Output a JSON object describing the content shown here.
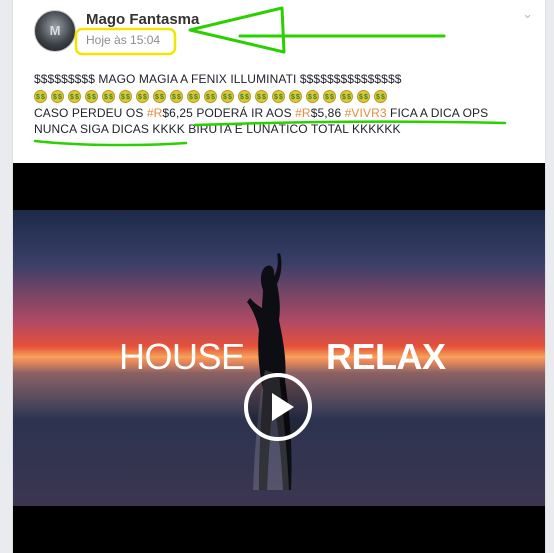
{
  "post": {
    "author": "Mago Fantasma",
    "avatar_letter": "M",
    "timestamp": "Hoje às 15:04",
    "line1": "$$$$$$$$$ MAGO MAGIA A FENIX ILLUMINATI $$$$$$$$$$$$$$$",
    "emoji_name": "money-mouth-face-emoji",
    "emoji_count": 21,
    "line3_a": "CASO PERDEU OS ",
    "line3_tag1": "#R",
    "line3_b": "$6,25 PODERÁ IR AOS ",
    "line3_tag2": "#R",
    "line3_c": "$5,86 ",
    "line3_tag3": "#VIVR3",
    "line3_d": " FICA A DICA OPS",
    "line4": "NUNCA SIGA DICAS KKKK BIRUTA E LUNÁTICO TOTAL KKKKKK"
  },
  "video": {
    "title_left": "HOUSE",
    "title_right": "RELAX"
  },
  "colors": {
    "hashtag": "#e98a3a",
    "annotation_green": "#2bd000",
    "annotation_yellow": "#f2e600"
  }
}
